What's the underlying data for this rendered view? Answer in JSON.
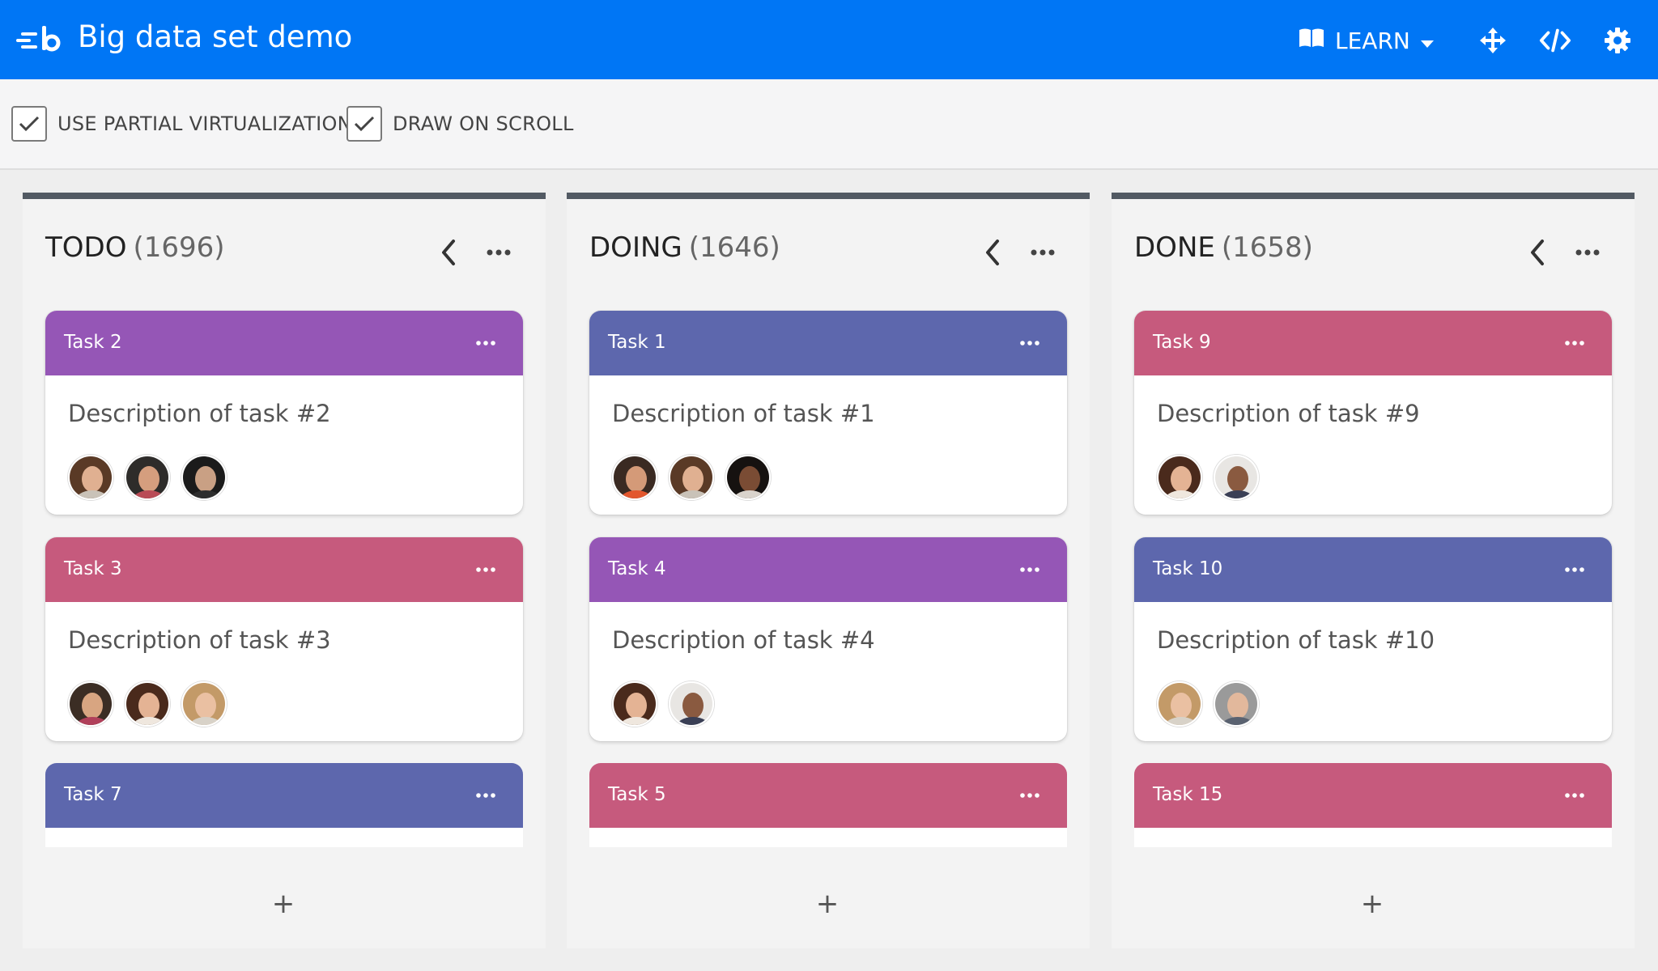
{
  "header": {
    "title": "Big data set demo",
    "logo_icon": "bryntum-logo-icon",
    "learn_label": "LEARN",
    "learn_icon": "book-icon",
    "icons": [
      "move-arrows-icon",
      "code-icon",
      "gear-icon"
    ],
    "colors": {
      "background": "#0076f5",
      "text": "#ffffff"
    }
  },
  "toolbar": {
    "checkboxes": [
      {
        "label": "USE PARTIAL VIRTUALIZATION",
        "checked": true
      },
      {
        "label": "DRAW ON SCROLL",
        "checked": true
      }
    ]
  },
  "columns": [
    {
      "title": "TODO",
      "count": "(1696)",
      "add_label": "+",
      "cards": [
        {
          "title": "Task 2",
          "description": "Description of task #2",
          "color": "#9556b6",
          "avatars": [
            "woman-avatar",
            "man-avatar",
            "man-avatar"
          ]
        },
        {
          "title": "Task 3",
          "description": "Description of task #3",
          "color": "#c65a7d",
          "avatars": [
            "man-avatar",
            "woman-avatar",
            "woman-avatar"
          ]
        },
        {
          "title": "Task 7",
          "description": "",
          "color": "#5d67ad",
          "avatars": []
        }
      ]
    },
    {
      "title": "DOING",
      "count": "(1646)",
      "add_label": "+",
      "cards": [
        {
          "title": "Task 1",
          "description": "Description of task #1",
          "color": "#5d67ad",
          "avatars": [
            "man-avatar",
            "woman-avatar",
            "woman-avatar"
          ]
        },
        {
          "title": "Task 4",
          "description": "Description of task #4",
          "color": "#9556b6",
          "avatars": [
            "woman-avatar",
            "man-avatar"
          ]
        },
        {
          "title": "Task 5",
          "description": "",
          "color": "#c65a7d",
          "avatars": []
        }
      ]
    },
    {
      "title": "DONE",
      "count": "(1658)",
      "add_label": "+",
      "cards": [
        {
          "title": "Task 9",
          "description": "Description of task #9",
          "color": "#c65a7d",
          "avatars": [
            "woman-avatar",
            "man-avatar"
          ]
        },
        {
          "title": "Task 10",
          "description": "Description of task #10",
          "color": "#5d67ad",
          "avatars": [
            "woman-avatar",
            "man-avatar"
          ]
        },
        {
          "title": "Task 15",
          "description": "",
          "color": "#c65a7d",
          "avatars": []
        }
      ]
    }
  ]
}
